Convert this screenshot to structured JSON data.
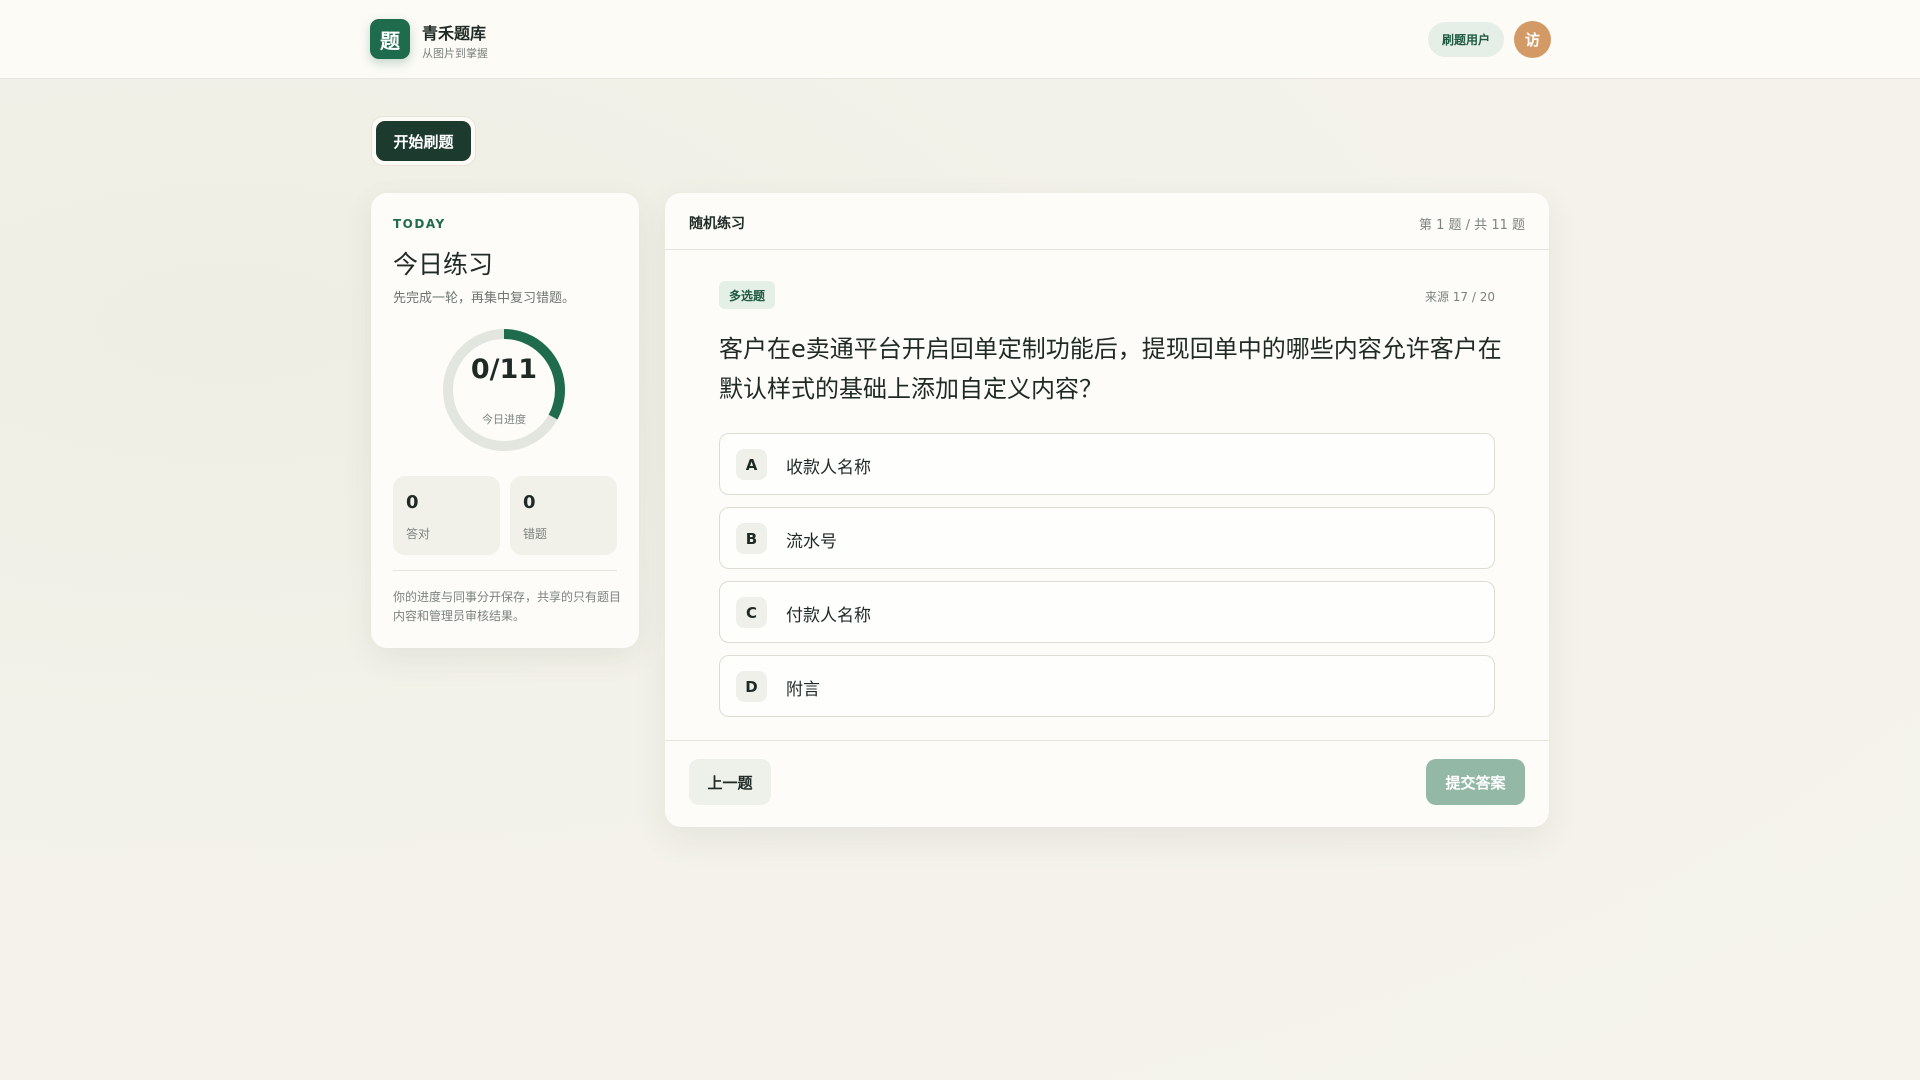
{
  "header": {
    "logo_glyph": "题",
    "brand_name": "青禾题库",
    "brand_tagline": "从图片到掌握",
    "user_label": "刷题用户",
    "avatar_glyph": "访"
  },
  "toolbar": {
    "start_label": "开始刷题"
  },
  "today": {
    "eyebrow": "TODAY",
    "title": "今日练习",
    "subtitle": "先完成一轮，再集中复习错题。",
    "progress_text": "0/11",
    "progress_label": "今日进度",
    "progress_fraction": 0.33,
    "correct_count": "0",
    "correct_label": "答对",
    "wrong_count": "0",
    "wrong_label": "错题",
    "note": "你的进度与同事分开保存，共享的只有题目内容和管理员审核结果。"
  },
  "question": {
    "mode_title": "随机练习",
    "position": "第 1 题 / 共 11 题",
    "type": "多选题",
    "source": "来源 17 / 20",
    "text": "客户在e卖通平台开启回单定制功能后，提现回单中的哪些内容允许客户在默认样式的基础上添加自定义内容？",
    "options": [
      {
        "letter": "A",
        "text": "收款人名称"
      },
      {
        "letter": "B",
        "text": "流水号"
      },
      {
        "letter": "C",
        "text": "付款人名称"
      },
      {
        "letter": "D",
        "text": "附言"
      }
    ],
    "prev_label": "上一题",
    "submit_label": "提交答案"
  },
  "colors": {
    "brand": "#1f6b4e",
    "ring_track": "#e3e6df",
    "avatar": "#d39a66",
    "submit_disabled": "#93b8a6"
  }
}
